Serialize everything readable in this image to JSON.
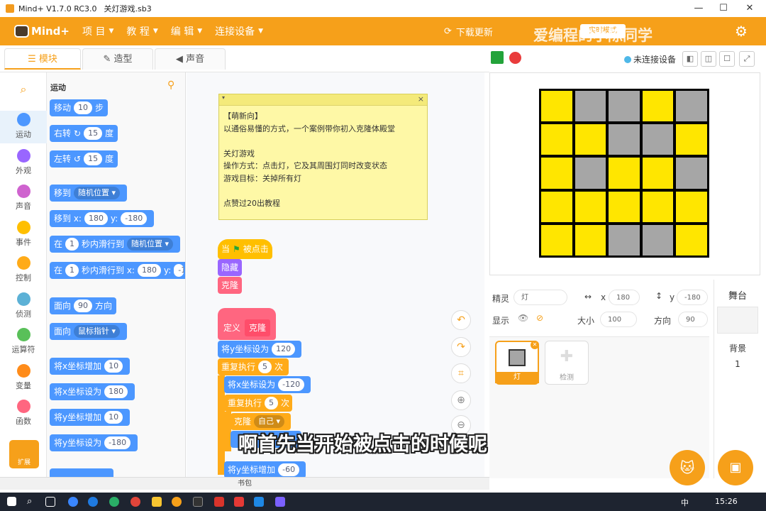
{
  "window": {
    "title": "Mind+ V1.7.0 RC3.0",
    "filename": "关灯游戏.sb3",
    "controls": [
      "—",
      "☐",
      "✕"
    ]
  },
  "menubar": {
    "logo": "Mind+",
    "items": [
      "项 目",
      "教 程",
      "编 辑",
      "连接设备"
    ],
    "download": "下载更新",
    "mode_button": "实时模式",
    "watermark": "爱编程的小陈同学"
  },
  "tabs": [
    "模块",
    "造型",
    "声音"
  ],
  "device_status": "未连接设备",
  "categories": [
    {
      "label": "运动",
      "color": "#4c97ff"
    },
    {
      "label": "外观",
      "color": "#9966ff"
    },
    {
      "label": "声音",
      "color": "#cf63cf"
    },
    {
      "label": "事件",
      "color": "#ffbf00"
    },
    {
      "label": "控制",
      "color": "#ffab19"
    },
    {
      "label": "侦测",
      "color": "#5cb1d6"
    },
    {
      "label": "运算符",
      "color": "#59c059"
    },
    {
      "label": "变量",
      "color": "#ff8c1a"
    },
    {
      "label": "函数",
      "color": "#ff6680"
    }
  ],
  "extension_label": "扩展",
  "palette": {
    "title": "运动",
    "blocks": {
      "move": {
        "a": "移动",
        "v": "10",
        "b": "步"
      },
      "turn_right": {
        "a": "右转",
        "v": "15",
        "b": "度"
      },
      "turn_left": {
        "a": "左转",
        "v": "15",
        "b": "度"
      },
      "goto": {
        "a": "移到",
        "d": "随机位置"
      },
      "goto_xy": {
        "a": "移到 x:",
        "x": "180",
        "m": "y:",
        "y": "-180"
      },
      "glide": {
        "a": "在",
        "v": "1",
        "b": "秒内滑行到",
        "d": "随机位置"
      },
      "glide_xy": {
        "a": "在",
        "v": "1",
        "b": "秒内滑行到 x:",
        "x": "180",
        "m": "y:"
      },
      "point_dir": {
        "a": "面向",
        "v": "90",
        "b": "方向"
      },
      "point_to": {
        "a": "面向",
        "d": "鼠标指针"
      },
      "change_x": {
        "a": "将x坐标增加",
        "v": "10"
      },
      "set_x": {
        "a": "将x坐标设为",
        "v": "180"
      },
      "change_y": {
        "a": "将y坐标增加",
        "v": "10"
      },
      "set_y": {
        "a": "将y坐标设为",
        "v": "-180"
      }
    }
  },
  "note": {
    "close": "×",
    "text": "【萌新向】\n以通俗易懂的方式，一个案例带你初入克隆体殿堂\n\n关灯游戏\n操作方式：点击灯，它及其周围灯同时改变状态\n游戏目标：关掉所有灯\n\n点赞过20出教程"
  },
  "script1": {
    "when": "当",
    "clicked": "被点击",
    "hide": "隐藏",
    "clone": "克隆"
  },
  "script2": {
    "define": "定义",
    "name": "克隆",
    "set_y": "将y坐标设为",
    "set_y_v": "120",
    "repeat": "重复执行",
    "repeat_v": "5",
    "times": "次",
    "set_x": "将x坐标设为",
    "set_x_v": "-120",
    "repeat2_v": "5",
    "clone": "克隆",
    "clone_d": "自己",
    "change_y": "将y坐标增加",
    "change_y_v": "-60"
  },
  "backpack": "书包",
  "subtitle": "啊首先当开始被点击的时候呢",
  "grid": [
    [
      "#ffe600",
      "#a6a6a6",
      "#a6a6a6",
      "#ffe600",
      "#a6a6a6"
    ],
    [
      "#ffe600",
      "#ffe600",
      "#a6a6a6",
      "#a6a6a6",
      "#ffe600"
    ],
    [
      "#ffe600",
      "#a6a6a6",
      "#ffe600",
      "#ffe600",
      "#a6a6a6"
    ],
    [
      "#ffe600",
      "#ffe600",
      "#ffe600",
      "#ffe600",
      "#ffe600"
    ],
    [
      "#ffe600",
      "#ffe600",
      "#a6a6a6",
      "#a6a6a6",
      "#ffe600"
    ]
  ],
  "sprite": {
    "sprite_label": "精灵",
    "name": "灯",
    "x_label": "x",
    "x": "180",
    "y_label": "y",
    "y": "-180",
    "show_label": "显示",
    "size_label": "大小",
    "size": "100",
    "dir_label": "方向",
    "dir": "90",
    "cards": [
      "灯",
      "检测"
    ]
  },
  "stage_panel": {
    "title": "舞台",
    "backdrop_label": "背景",
    "backdrop_count": "1"
  },
  "taskbar": {
    "time": "15:26",
    "ime": "中"
  }
}
